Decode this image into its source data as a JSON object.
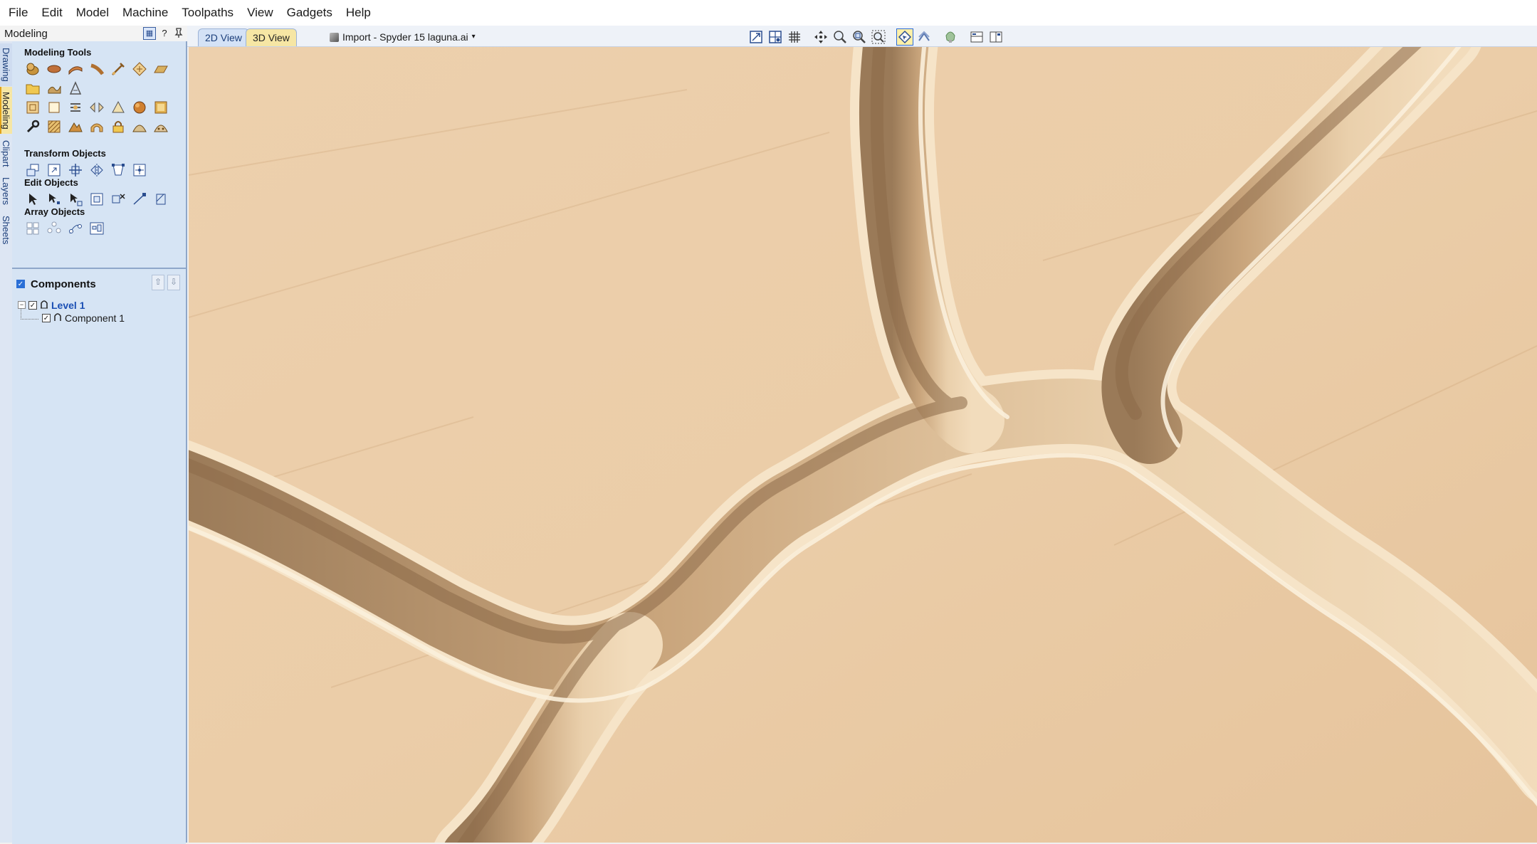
{
  "menu": {
    "items": [
      "File",
      "Edit",
      "Model",
      "Machine",
      "Toolpaths",
      "View",
      "Gadgets",
      "Help"
    ]
  },
  "panel": {
    "title": "Modeling",
    "help_label": "?",
    "pin_label": "📌"
  },
  "view_tabs": {
    "tab_2d": "2D View",
    "tab_3d": "3D View",
    "active": "3D View"
  },
  "document": {
    "name": "Import - Spyder 15 laguna.ai"
  },
  "side_tabs": [
    "Drawing",
    "Modeling",
    "Clipart",
    "Layers",
    "Sheets"
  ],
  "sections": {
    "modeling_tools": "Modeling Tools",
    "transform_objects": "Transform Objects",
    "edit_objects": "Edit Objects",
    "array_objects": "Array Objects"
  },
  "components": {
    "title": "Components",
    "level_label": "Level 1",
    "component_label": "Component 1"
  },
  "colors": {
    "panel_bg": "#d6e4f4",
    "viewport_bg": "#e8c9a4",
    "active_tab": "#f6e6a4",
    "link_blue": "#1b4fb4"
  }
}
